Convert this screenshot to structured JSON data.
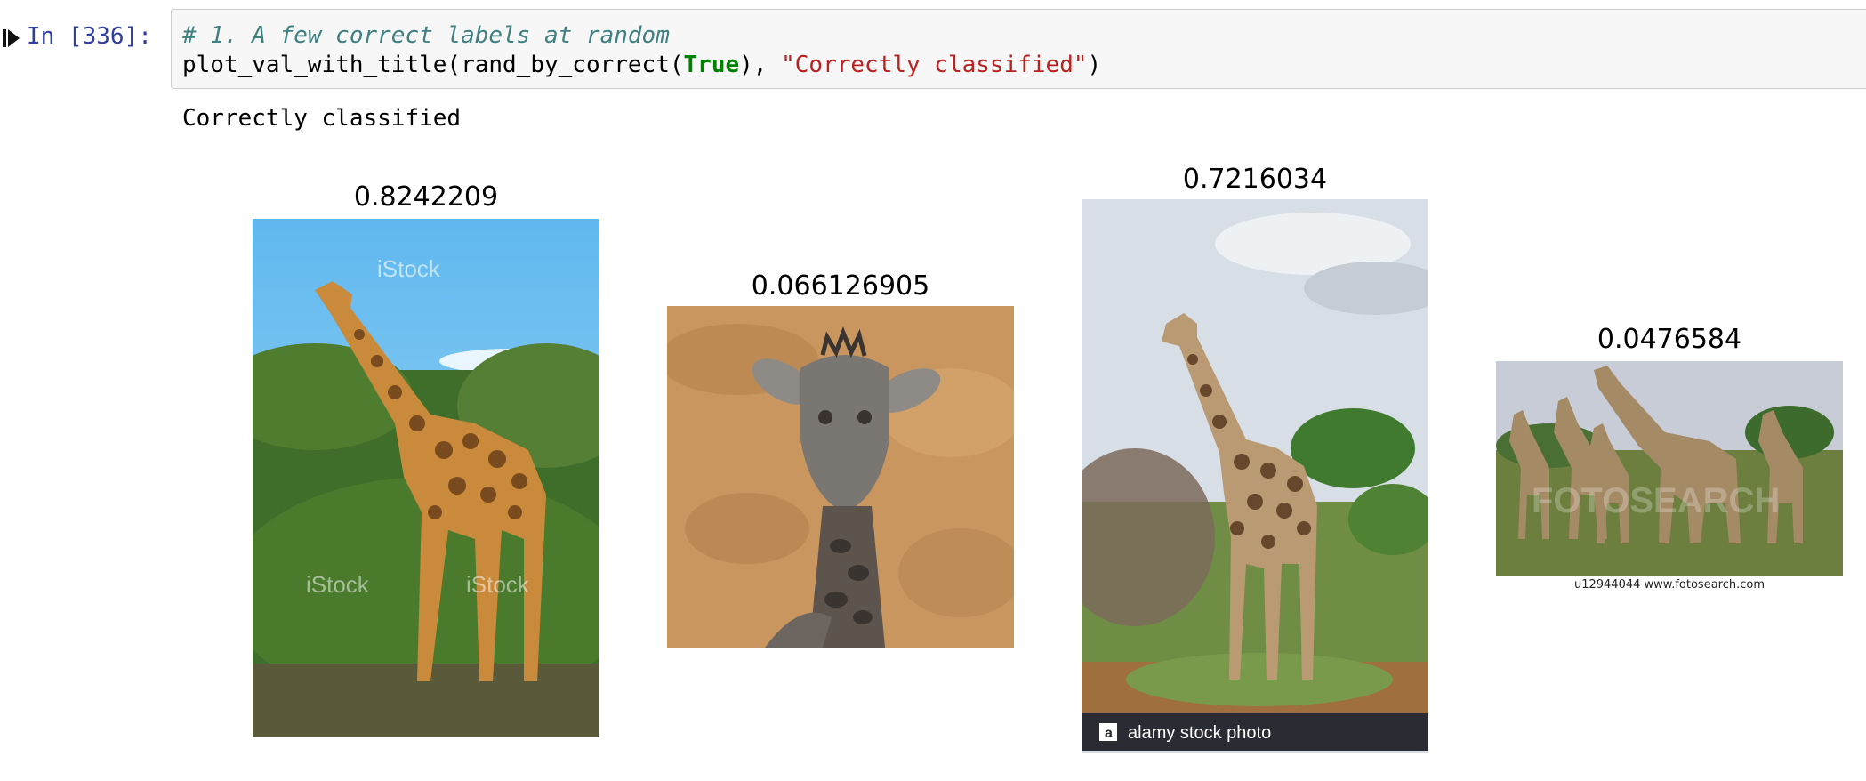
{
  "cell": {
    "prompt": "In [336]:",
    "code_comment": "# 1. A few correct labels at random",
    "code_fn": "plot_val_with_title(rand_by_correct(",
    "code_kw": "True",
    "code_mid": "), ",
    "code_string": "\"Correctly classified\"",
    "code_end": ")"
  },
  "output": {
    "stdout": "Correctly classified",
    "images": [
      {
        "title": "0.8242209",
        "subject": "giraffe-standing-bushes",
        "watermark": "iStock"
      },
      {
        "title": "0.066126905",
        "subject": "baby-giraffe-head"
      },
      {
        "title": "0.7216034",
        "subject": "giraffe-savanna",
        "watermark": "alamy stock photo"
      },
      {
        "title": "0.0476584",
        "subject": "giraffe-herd",
        "watermark": "FOTOSEARCH",
        "caption": "u12944044 www.fotosearch.com"
      }
    ]
  },
  "colors": {
    "prompt": "#303f9f",
    "comment": "#408080",
    "keyword": "#008000",
    "string": "#ba2121",
    "input_bg": "#f7f7f7"
  }
}
